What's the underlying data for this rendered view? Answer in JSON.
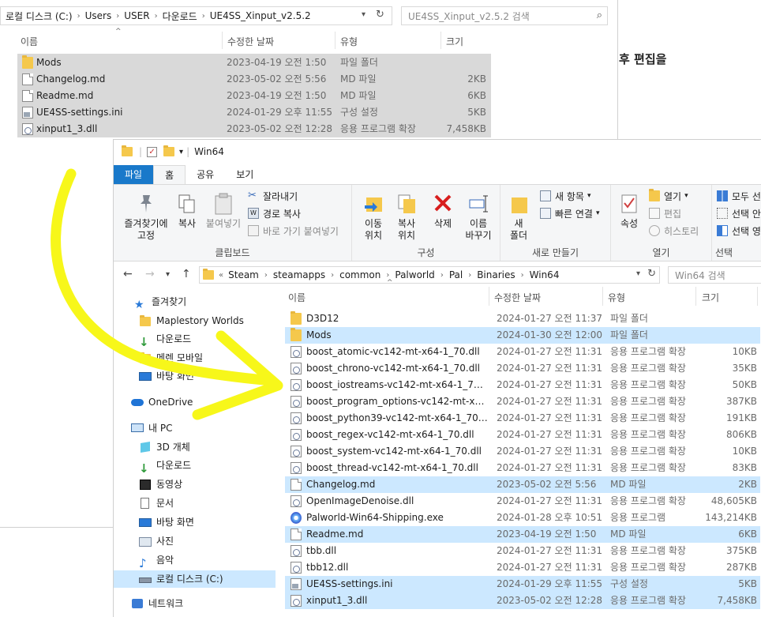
{
  "back_window": {
    "address": [
      "로컬 디스크 (C:)",
      "Users",
      "USER",
      "다운로드",
      "UE4SS_Xinput_v2.5.2"
    ],
    "search_placeholder": "UE4SS_Xinput_v2.5.2 검색",
    "columns": {
      "name": "이름",
      "date": "수정한 날짜",
      "type": "유형",
      "size": "크기"
    },
    "files": [
      {
        "icon": "folder",
        "name": "Mods",
        "date": "2023-04-19 오전 1:50",
        "type": "파일 폴더",
        "size": ""
      },
      {
        "icon": "file",
        "name": "Changelog.md",
        "date": "2023-05-02 오전 5:56",
        "type": "MD 파일",
        "size": "2KB"
      },
      {
        "icon": "file",
        "name": "Readme.md",
        "date": "2023-04-19 오전 1:50",
        "type": "MD 파일",
        "size": "6KB"
      },
      {
        "icon": "ini",
        "name": "UE4SS-settings.ini",
        "date": "2024-01-29 오후 11:55",
        "type": "구성 설정",
        "size": "5KB"
      },
      {
        "icon": "dll",
        "name": "xinput1_3.dll",
        "date": "2023-05-02 오전 12:28",
        "type": "응용 프로그램 확장",
        "size": "7,458KB"
      }
    ]
  },
  "background_text": "후 편집을",
  "front_window": {
    "title": "Win64",
    "tabs": [
      "파일",
      "홈",
      "공유",
      "보기"
    ],
    "ribbon": {
      "clipboard": {
        "pin": "즐겨찾기에\n고정",
        "copy": "복사",
        "paste": "붙여넣기",
        "cut": "잘라내기",
        "copy_path": "경로 복사",
        "paste_shortcut": "바로 가기 붙여넣기",
        "label": "클립보드"
      },
      "organize": {
        "move": "이동\n위치",
        "copy_to": "복사\n위치",
        "delete": "삭제",
        "rename": "이름\n바꾸기",
        "label": "구성"
      },
      "new": {
        "new_folder": "새\n폴더",
        "new_item": "새 항목",
        "easy_access": "빠른 연결",
        "label": "새로 만들기"
      },
      "open": {
        "properties": "속성",
        "open": "열기",
        "edit": "편집",
        "history": "히스토리",
        "label": "열기"
      },
      "select": {
        "select_all": "모두 선",
        "select_none": "선택 안",
        "invert": "선택 영",
        "label": "선택"
      }
    },
    "address": [
      "Steam",
      "steamapps",
      "common",
      "Palworld",
      "Pal",
      "Binaries",
      "Win64"
    ],
    "search_placeholder": "Win64 검색",
    "sidebar": [
      {
        "icon": "star",
        "label": "즐겨찾기"
      },
      {
        "icon": "folder",
        "label": "Maplestory Worlds"
      },
      {
        "icon": "download",
        "label": "다운로드"
      },
      {
        "icon": "folder",
        "label": "메렌 모바일"
      },
      {
        "icon": "desktop",
        "label": "바탕 화면"
      },
      {
        "icon": "cloud",
        "label": "OneDrive"
      },
      {
        "icon": "pc",
        "label": "내 PC"
      },
      {
        "icon": "cube",
        "label": "3D 개체"
      },
      {
        "icon": "download",
        "label": "다운로드"
      },
      {
        "icon": "video",
        "label": "동영상"
      },
      {
        "icon": "doc",
        "label": "문서"
      },
      {
        "icon": "desktop",
        "label": "바탕 화면"
      },
      {
        "icon": "picture",
        "label": "사진"
      },
      {
        "icon": "music",
        "label": "음악"
      },
      {
        "icon": "drive",
        "label": "로컬 디스크 (C:)"
      },
      {
        "icon": "network",
        "label": "네트워크"
      }
    ],
    "columns": {
      "name": "이름",
      "date": "수정한 날짜",
      "type": "유형",
      "size": "크기"
    },
    "files": [
      {
        "icon": "folder",
        "name": "D3D12",
        "date": "2024-01-27 오전 11:37",
        "type": "파일 폴더",
        "size": "",
        "sel": false
      },
      {
        "icon": "folder",
        "name": "Mods",
        "date": "2024-01-30 오전 12:00",
        "type": "파일 폴더",
        "size": "",
        "sel": true
      },
      {
        "icon": "dll",
        "name": "boost_atomic-vc142-mt-x64-1_70.dll",
        "date": "2024-01-27 오전 11:31",
        "type": "응용 프로그램 확장",
        "size": "10KB",
        "sel": false
      },
      {
        "icon": "dll",
        "name": "boost_chrono-vc142-mt-x64-1_70.dll",
        "date": "2024-01-27 오전 11:31",
        "type": "응용 프로그램 확장",
        "size": "35KB",
        "sel": false
      },
      {
        "icon": "dll",
        "name": "boost_iostreams-vc142-mt-x64-1_70.dll",
        "date": "2024-01-27 오전 11:31",
        "type": "응용 프로그램 확장",
        "size": "50KB",
        "sel": false
      },
      {
        "icon": "dll",
        "name": "boost_program_options-vc142-mt-x64-...",
        "date": "2024-01-27 오전 11:31",
        "type": "응용 프로그램 확장",
        "size": "387KB",
        "sel": false
      },
      {
        "icon": "dll",
        "name": "boost_python39-vc142-mt-x64-1_70.dll",
        "date": "2024-01-27 오전 11:31",
        "type": "응용 프로그램 확장",
        "size": "191KB",
        "sel": false
      },
      {
        "icon": "dll",
        "name": "boost_regex-vc142-mt-x64-1_70.dll",
        "date": "2024-01-27 오전 11:31",
        "type": "응용 프로그램 확장",
        "size": "806KB",
        "sel": false
      },
      {
        "icon": "dll",
        "name": "boost_system-vc142-mt-x64-1_70.dll",
        "date": "2024-01-27 오전 11:31",
        "type": "응용 프로그램 확장",
        "size": "10KB",
        "sel": false
      },
      {
        "icon": "dll",
        "name": "boost_thread-vc142-mt-x64-1_70.dll",
        "date": "2024-01-27 오전 11:31",
        "type": "응용 프로그램 확장",
        "size": "83KB",
        "sel": false
      },
      {
        "icon": "file",
        "name": "Changelog.md",
        "date": "2023-05-02 오전 5:56",
        "type": "MD 파일",
        "size": "2KB",
        "sel": true
      },
      {
        "icon": "dll",
        "name": "OpenImageDenoise.dll",
        "date": "2024-01-27 오전 11:31",
        "type": "응용 프로그램 확장",
        "size": "48,605KB",
        "sel": false
      },
      {
        "icon": "exe",
        "name": "Palworld-Win64-Shipping.exe",
        "date": "2024-01-28 오후 10:51",
        "type": "응용 프로그램",
        "size": "143,214KB",
        "sel": false
      },
      {
        "icon": "file",
        "name": "Readme.md",
        "date": "2023-04-19 오전 1:50",
        "type": "MD 파일",
        "size": "6KB",
        "sel": true
      },
      {
        "icon": "dll",
        "name": "tbb.dll",
        "date": "2024-01-27 오전 11:31",
        "type": "응용 프로그램 확장",
        "size": "375KB",
        "sel": false
      },
      {
        "icon": "dll",
        "name": "tbb12.dll",
        "date": "2024-01-27 오전 11:31",
        "type": "응용 프로그램 확장",
        "size": "287KB",
        "sel": false
      },
      {
        "icon": "ini",
        "name": "UE4SS-settings.ini",
        "date": "2024-01-29 오후 11:55",
        "type": "구성 설정",
        "size": "5KB",
        "sel": true
      },
      {
        "icon": "dll",
        "name": "xinput1_3.dll",
        "date": "2023-05-02 오전 12:28",
        "type": "응용 프로그램 확장",
        "size": "7,458KB",
        "sel": true
      }
    ]
  },
  "colors": {
    "selection": "#cce8ff",
    "back_selection": "#d9d9d9",
    "ribbon_file_tab": "#1979ca",
    "annotation_arrow": "#f7f71a"
  }
}
